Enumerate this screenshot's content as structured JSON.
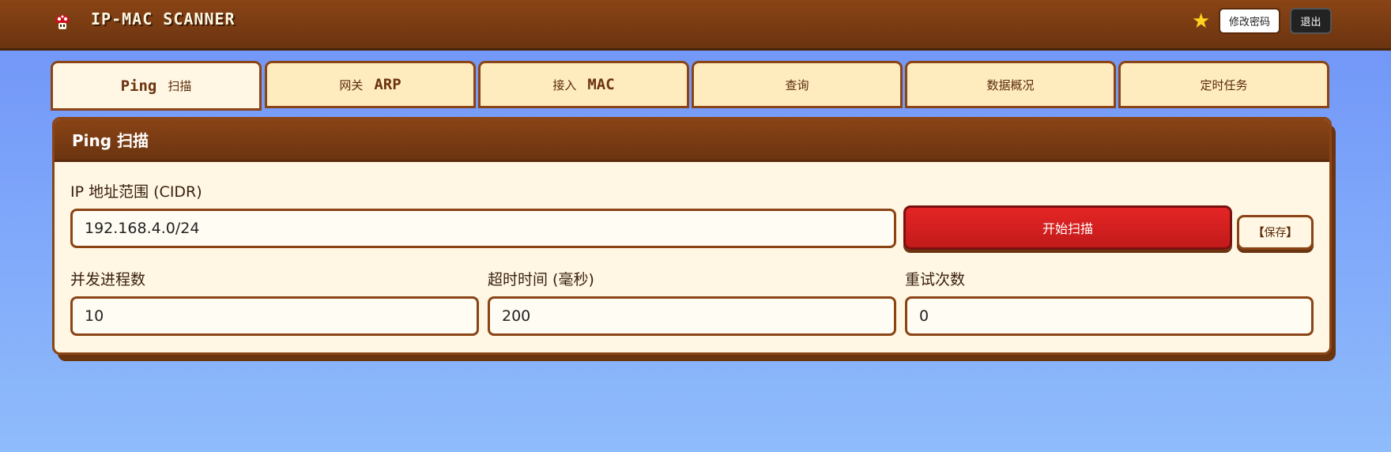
{
  "app": {
    "title": "IP-MAC SCANNER",
    "change_password_label": "修改密码",
    "logout_label": "退出",
    "star_glyph": "★",
    "logo_icon": "mushroom-icon"
  },
  "tabs": [
    {
      "pre": "Ping",
      "post": "扫描",
      "active": true
    },
    {
      "pre": "网关",
      "post": "ARP",
      "active": false
    },
    {
      "pre": "接入",
      "post": "MAC",
      "active": false
    },
    {
      "pre": "查询",
      "post": "",
      "active": false
    },
    {
      "pre": "数据概况",
      "post": "",
      "active": false
    },
    {
      "pre": "定时任务",
      "post": "",
      "active": false
    }
  ],
  "panel": {
    "title": "Ping 扫描",
    "ip_range_label": "IP 地址范围 (CIDR)",
    "ip_range_value": "192.168.4.0/24",
    "scan_button_label": "开始扫描",
    "save_button_label": "保存",
    "concurrency_label": "并发进程数",
    "concurrency_value": "10",
    "timeout_label": "超时时间 (毫秒)",
    "timeout_value": "200",
    "retry_label": "重试次数",
    "retry_value": "0"
  },
  "colors": {
    "brown": "#8a4415",
    "cream": "#fff7e3",
    "tab_bg": "#feecbf",
    "scan_red": "#d82020",
    "star_yellow": "#ffd21f"
  }
}
